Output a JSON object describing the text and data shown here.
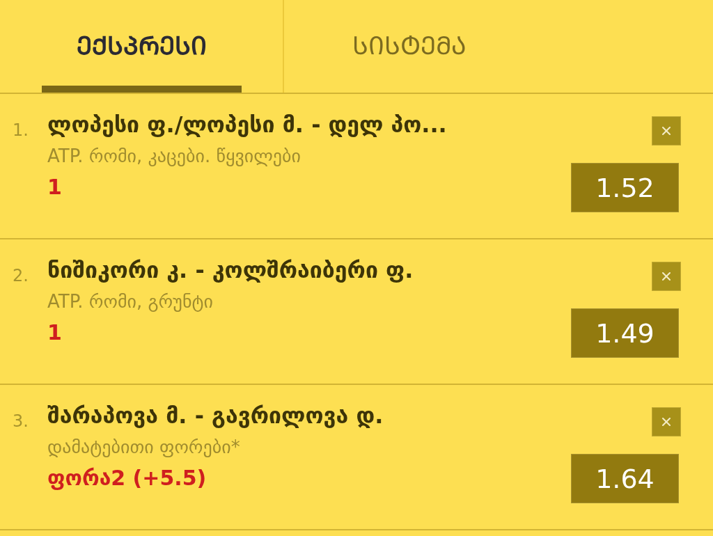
{
  "tabs": [
    {
      "label": "ᲔᲥᲡᲞᲠᲔᲡᲘ",
      "selected": true
    },
    {
      "label": "ᲡᲘᲡᲢᲔᲛᲐ",
      "selected": false
    }
  ],
  "bets": [
    {
      "number": "1.",
      "title": "ლოპესი ფ./ლოპესი მ. - დელ პო...",
      "league": "ATP. რომი, კაცები. წყვილები",
      "pick": "1",
      "odds": "1.52"
    },
    {
      "number": "2.",
      "title": "ნიშიკორი კ. - კოლშრაიბერი ფ.",
      "league": "ATP. რომი, გრუნტი",
      "pick": "1",
      "odds": "1.49"
    },
    {
      "number": "3.",
      "title": "შარაპოვა მ. - გავრილოვა დ.",
      "league": "დამატებითი ფორები*",
      "pick": "ფორა2 (+5.5)",
      "odds": "1.64"
    }
  ]
}
